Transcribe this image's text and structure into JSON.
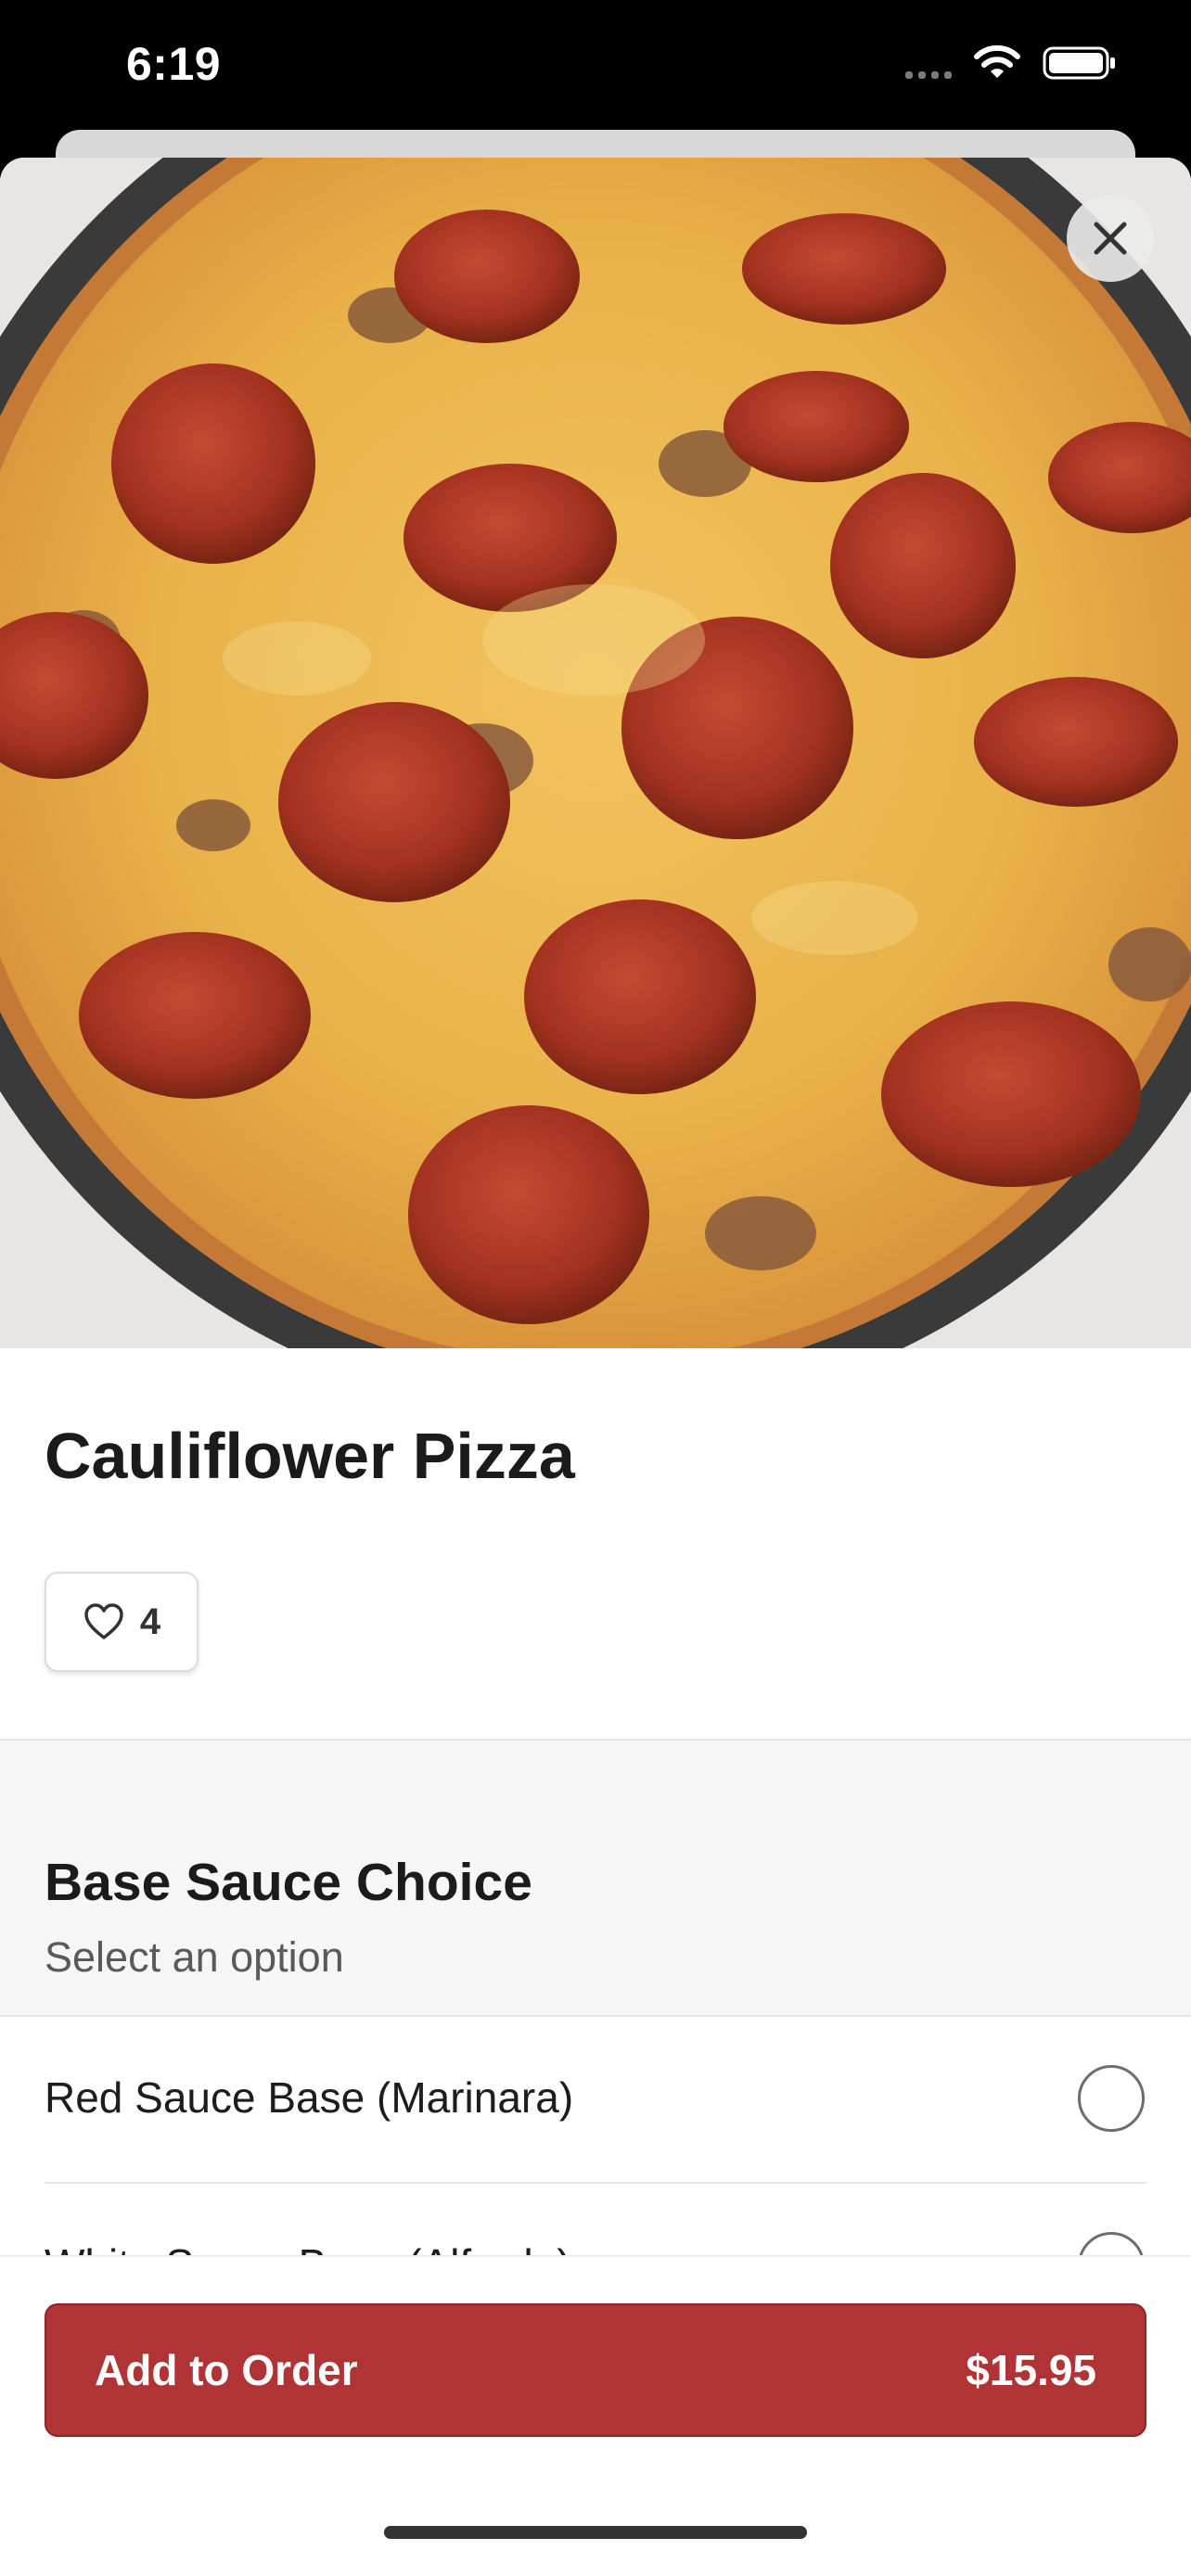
{
  "status_bar": {
    "time": "6:19"
  },
  "item": {
    "title": "Cauliflower Pizza",
    "likes": "4"
  },
  "options_section": {
    "title": "Base Sauce Choice",
    "subtitle": "Select an option",
    "options": [
      {
        "label": "Red Sauce Base (Marinara)"
      },
      {
        "label": "White Sauce Base (Alfredo)"
      }
    ]
  },
  "order_button": {
    "label": "Add to Order",
    "price": "$15.95"
  },
  "colors": {
    "accent": "#b03436"
  }
}
